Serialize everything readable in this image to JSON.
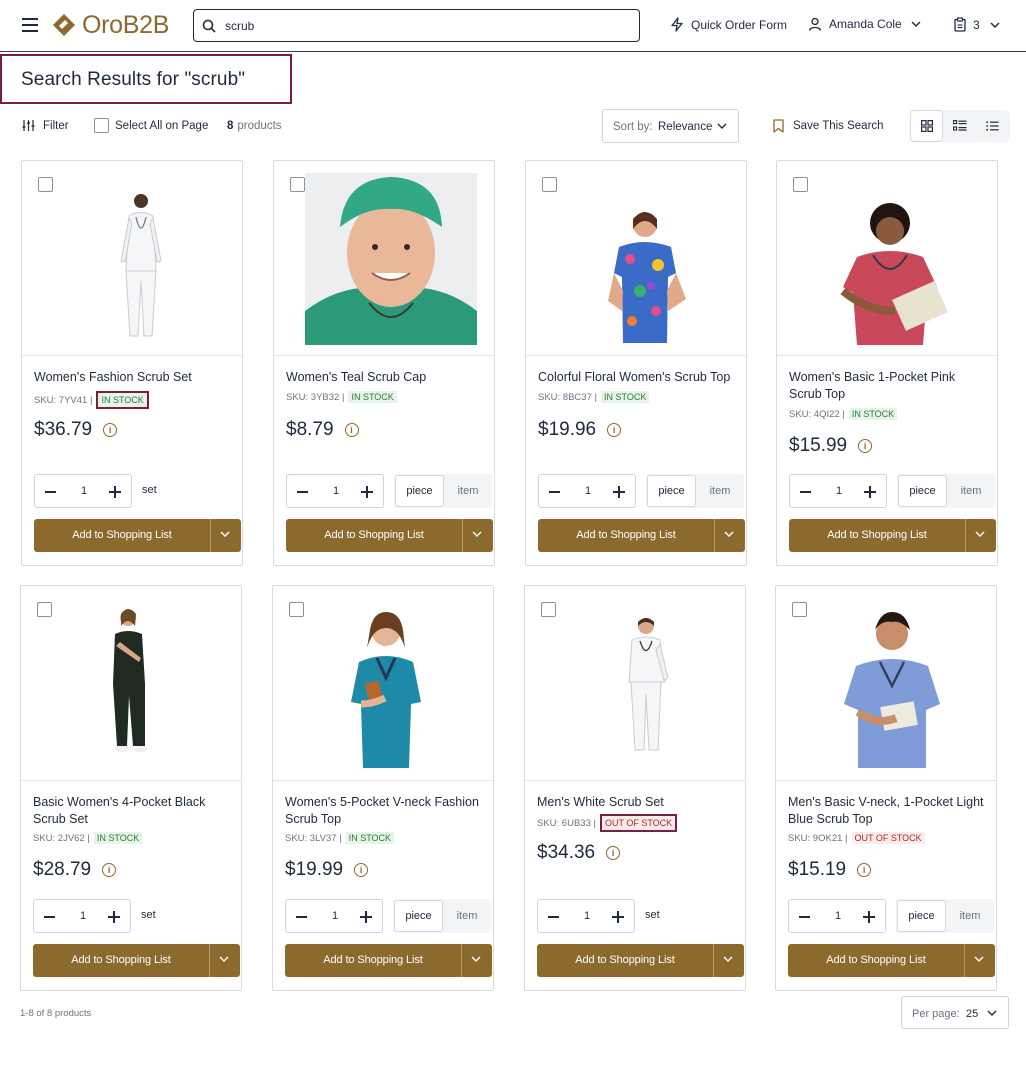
{
  "header": {
    "brand": "OroB2B",
    "search_value": "scrub",
    "quick_order": "Quick Order Form",
    "user_name": "Amanda Cole",
    "cart_count": "3"
  },
  "page": {
    "title": "Search Results for \"scrub\""
  },
  "toolbar": {
    "filter_label": "Filter",
    "select_all_label": "Select All on Page",
    "products_count": "8",
    "products_label": "products",
    "sort_label": "Sort by:",
    "sort_value": "Relevance",
    "save_search_label": "Save This Search"
  },
  "products": [
    {
      "name": "Women's Fashion Scrub Set",
      "sku": "SKU: 7YV41",
      "stock": "IN STOCK",
      "price": "$36.79",
      "qty": "1",
      "unit": "set",
      "add_label": "Add to Shopping List"
    },
    {
      "name": "Women's Teal Scrub Cap",
      "sku": "SKU: 3YB32",
      "stock": "IN STOCK",
      "price": "$8.79",
      "qty": "1",
      "unit_a": "piece",
      "unit_b": "item",
      "add_label": "Add to Shopping List"
    },
    {
      "name": "Colorful Floral Women's Scrub Top",
      "sku": "SKU: 8BC37",
      "stock": "IN STOCK",
      "price": "$19.96",
      "qty": "1",
      "unit_a": "piece",
      "unit_b": "item",
      "add_label": "Add to Shopping List"
    },
    {
      "name": "Women's Basic 1-Pocket Pink Scrub Top",
      "sku": "SKU: 4QI22",
      "stock": "IN STOCK",
      "price": "$15.99",
      "qty": "1",
      "unit_a": "piece",
      "unit_b": "item",
      "add_label": "Add to Shopping List"
    },
    {
      "name": "Basic Women's 4-Pocket Black Scrub Set",
      "sku": "SKU: 2JV62",
      "stock": "IN STOCK",
      "price": "$28.79",
      "qty": "1",
      "unit": "set",
      "add_label": "Add to Shopping List"
    },
    {
      "name": "Women's 5-Pocket V-neck Fashion Scrub Top",
      "sku": "SKU: 3LV37",
      "stock": "IN STOCK",
      "price": "$19.99",
      "qty": "1",
      "unit_a": "piece",
      "unit_b": "item",
      "add_label": "Add to Shopping List"
    },
    {
      "name": "Men's White Scrub Set",
      "sku": "SKU: 6UB33",
      "stock": "OUT OF STOCK",
      "price": "$34.36",
      "qty": "1",
      "unit": "set",
      "add_label": "Add to Shopping List"
    },
    {
      "name": "Men's Basic V-neck, 1-Pocket Light Blue Scrub Top",
      "sku": "SKU: 9OK21",
      "stock": "OUT OF STOCK",
      "price": "$15.19",
      "qty": "1",
      "unit_a": "piece",
      "unit_b": "item",
      "add_label": "Add to Shopping List"
    }
  ],
  "footer": {
    "range_text": "1-8 of 8 products",
    "per_page_label": "Per page:",
    "per_page_value": "25"
  },
  "colors": {
    "brand": "#8c6a2e",
    "highlight": "#7a1f3d",
    "in_stock": "#2e7d32",
    "out_of_stock": "#b3261e"
  },
  "icons": [
    "menu-icon",
    "logo-icon",
    "search-icon",
    "bolt-icon",
    "user-icon",
    "chevron-down-icon",
    "clipboard-icon",
    "filter-icon",
    "bookmark-icon",
    "grid-view-icon",
    "list-view-icon",
    "compact-list-icon",
    "info-icon"
  ]
}
